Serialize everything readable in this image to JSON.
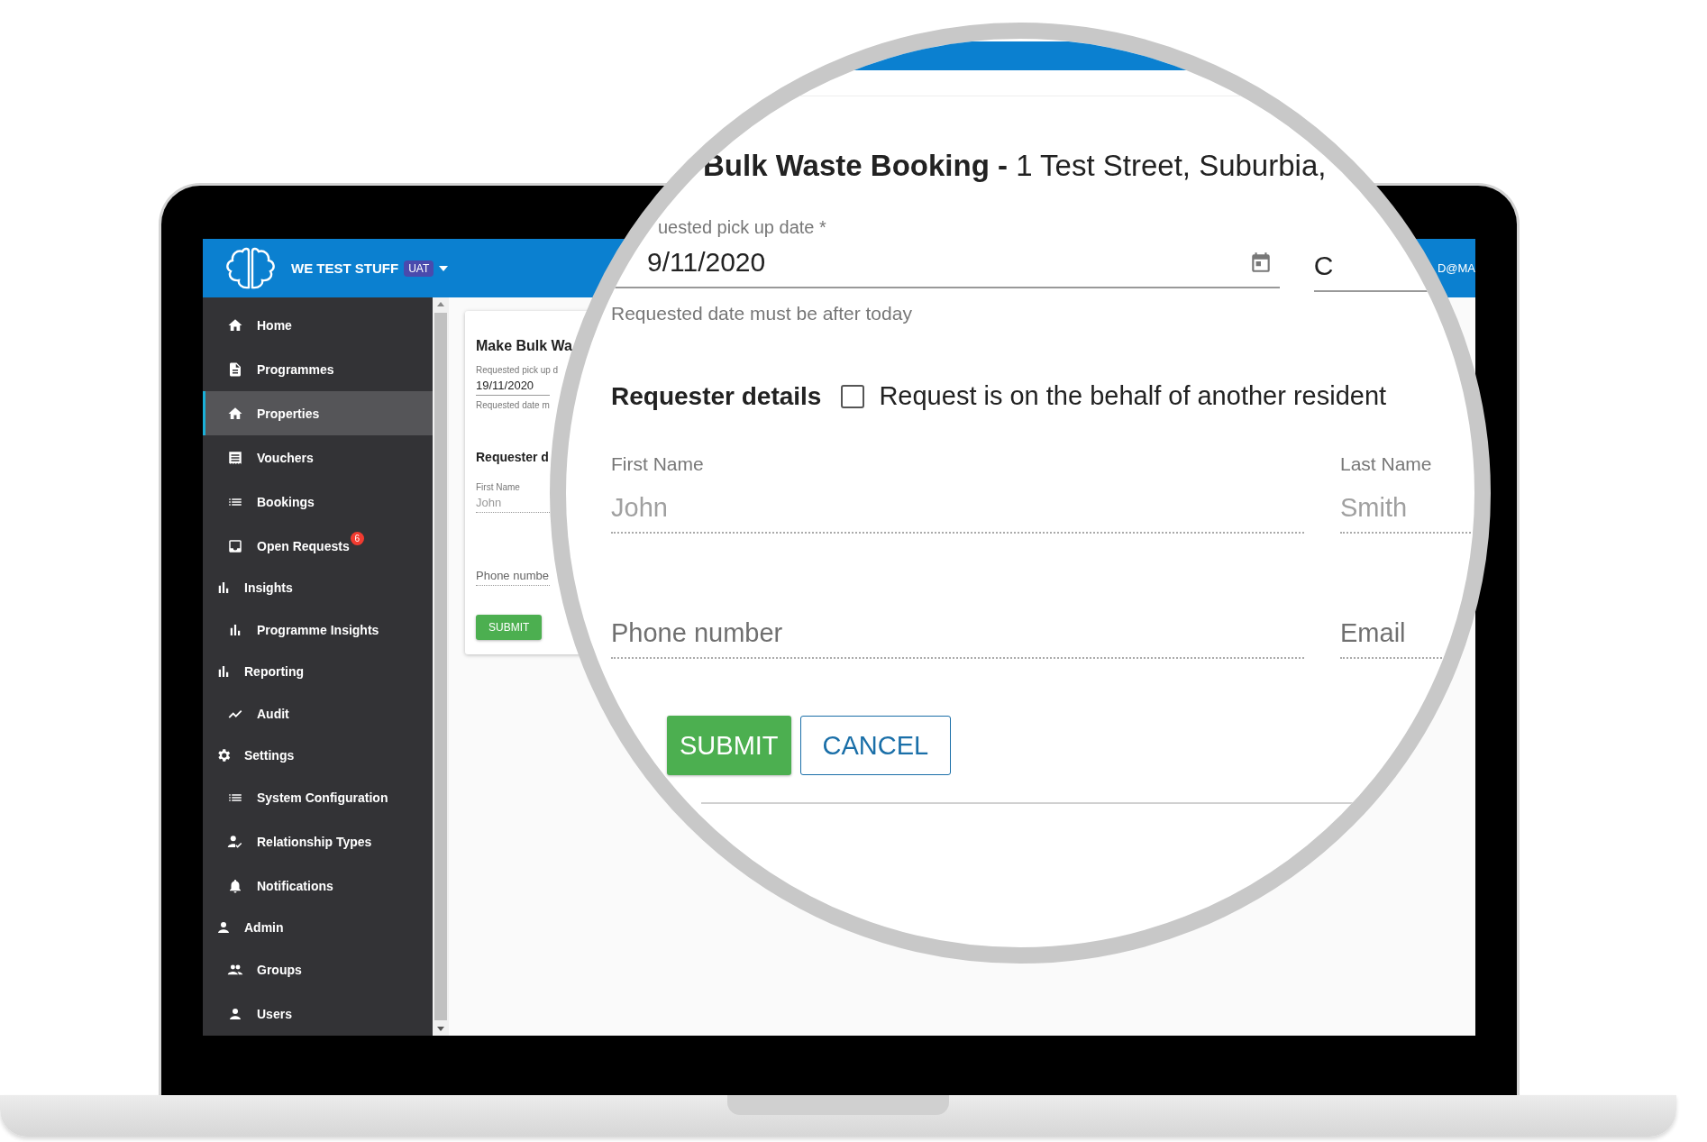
{
  "app_header": {
    "brand": "WE TEST STUFF",
    "badge": "UAT",
    "user": "D@MA"
  },
  "sidebar": {
    "items": [
      {
        "kind": "link",
        "label": "Home",
        "selected": false
      },
      {
        "kind": "link",
        "label": "Programmes",
        "selected": false
      },
      {
        "kind": "link",
        "label": "Properties",
        "selected": true
      },
      {
        "kind": "link",
        "label": "Vouchers",
        "selected": false
      },
      {
        "kind": "link",
        "label": "Bookings",
        "selected": false
      },
      {
        "kind": "link",
        "label": "Open Requests",
        "selected": false,
        "badge": "6"
      },
      {
        "kind": "section",
        "label": "Insights",
        "children": [
          {
            "kind": "link",
            "label": "Programme Insights",
            "selected": false
          }
        ]
      },
      {
        "kind": "section",
        "label": "Reporting",
        "children": [
          {
            "kind": "link",
            "label": "Audit",
            "selected": false
          }
        ]
      },
      {
        "kind": "section",
        "label": "Settings",
        "children": [
          {
            "kind": "link",
            "label": "System Configuration",
            "selected": false
          },
          {
            "kind": "link",
            "label": "Relationship Types",
            "selected": false
          },
          {
            "kind": "link",
            "label": "Notifications",
            "selected": false
          }
        ]
      },
      {
        "kind": "section",
        "label": "Admin",
        "children": [
          {
            "kind": "link",
            "label": "Groups",
            "selected": false
          },
          {
            "kind": "link",
            "label": "Users",
            "selected": false
          }
        ]
      }
    ]
  },
  "form_card": {
    "title": "Make Bulk Wa",
    "date_field": {
      "label": "Requested pick up d",
      "value": "19/11/2020",
      "hint": "Requested date m",
      "disabled": false
    },
    "requester_heading": "Requester d",
    "first_name": {
      "label": "First Name",
      "value": "John",
      "disabled": true
    },
    "phone": {
      "placeholder": "Phone numbe",
      "disabled": true
    },
    "buttons": [
      {
        "kind": "primary",
        "label": "SUBMIT"
      }
    ]
  },
  "magnifier": {
    "title": "**Bulk Waste Booking -** 1 Test Street, Suburbia,",
    "date_field": {
      "label": "uested pick up date *",
      "value": "9/11/2020",
      "hint": "Requested date must be after today",
      "disabled": false
    },
    "side_field": {
      "value": "C"
    },
    "requester_heading": "Requester details",
    "behalf_checkbox": {
      "label": "Request is on the behalf of another resident",
      "checked": false
    },
    "fields": [
      {
        "label": "First Name",
        "value": "John",
        "disabled": true
      },
      {
        "label": "Last Name",
        "value": "Smith",
        "disabled": true
      },
      {
        "placeholder": "Phone number",
        "disabled": true
      },
      {
        "placeholder": "Email",
        "disabled": true
      }
    ],
    "buttons": [
      {
        "kind": "primary",
        "label": "SUBMIT"
      },
      {
        "kind": "outline",
        "label": "CANCEL"
      }
    ]
  }
}
